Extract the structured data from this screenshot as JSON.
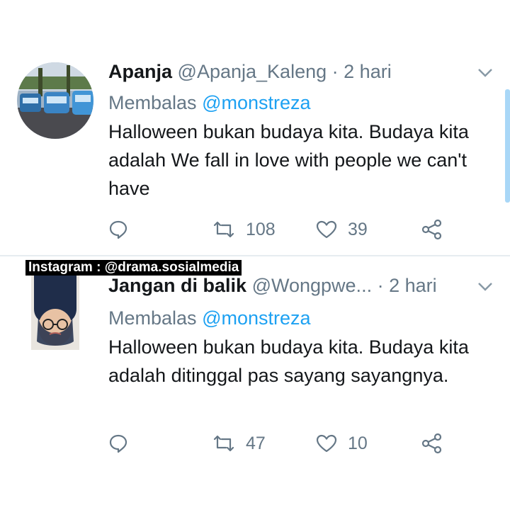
{
  "tweets": [
    {
      "name": "Apanja",
      "handle": "@Apanja_Kaleng",
      "separator": "·",
      "time": "2 hari",
      "reply_prefix": "Membalas",
      "reply_mention": "@monstreza",
      "text": "Halloween bukan budaya kita. Budaya kita adalah We fall in love with people we can't have",
      "retweets": "108",
      "likes": "39",
      "avatar_icon": "street-photo-avatar"
    },
    {
      "name": "Jangan di balik",
      "handle": "@Wongpwe...",
      "separator": "·",
      "time": "2 hari",
      "reply_prefix": "Membalas",
      "reply_mention": "@monstreza",
      "text": "Halloween bukan budaya kita. Budaya kita adalah ditinggal pas sayang sayangnya.",
      "retweets": "47",
      "likes": "10",
      "avatar_icon": "upside-down-person-avatar"
    }
  ],
  "watermark": "Instagram : @drama.sosialmedia",
  "icons": [
    "chevron-down-icon",
    "reply-icon",
    "retweet-icon",
    "like-icon",
    "share-icon"
  ],
  "colors": {
    "accent": "#1da1f2",
    "secondary_text": "#657786",
    "primary_text": "#14171a",
    "divider": "#e6ecf0"
  }
}
